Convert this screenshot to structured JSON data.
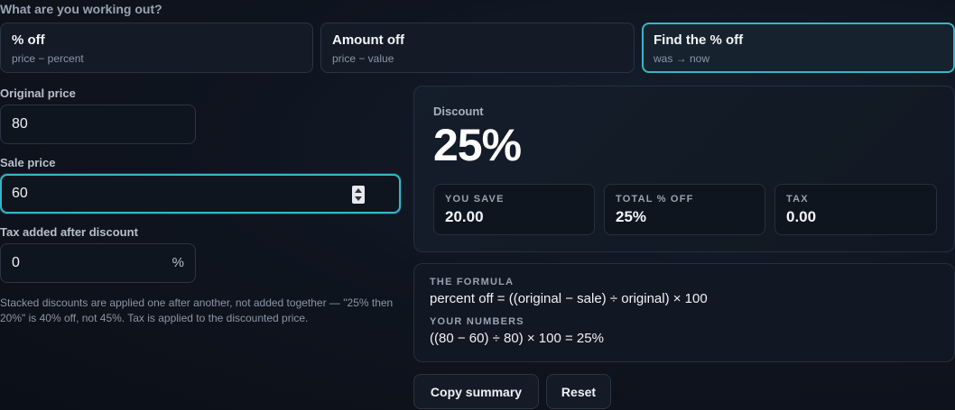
{
  "question": "What are you working out?",
  "modes": [
    {
      "title": "% off",
      "sub": "price − percent"
    },
    {
      "title": "Amount off",
      "sub": "price − value"
    },
    {
      "title": "Find the % off",
      "sub": "was → now"
    }
  ],
  "inputs": {
    "original_label": "Original price",
    "original_value": "80",
    "sale_label": "Sale price",
    "sale_value": "60",
    "tax_label": "Tax added after discount",
    "tax_value": "0",
    "tax_unit": "%"
  },
  "note": "Stacked discounts are applied one after another, not added together — \"25% then 20%\" is 40% off, not 45%. Tax is applied to the discounted price.",
  "result": {
    "label": "Discount",
    "value": "25%",
    "stats": [
      {
        "key": "YOU SAVE",
        "value": "20.00"
      },
      {
        "key": "TOTAL % OFF",
        "value": "25%"
      },
      {
        "key": "TAX",
        "value": "0.00"
      }
    ]
  },
  "formula": {
    "heading": "THE FORMULA",
    "text": "percent off = ((original − sale) ÷ original) × 100",
    "numbers_heading": "YOUR NUMBERS",
    "numbers": "((80 − 60) ÷ 80) × 100 = 25%"
  },
  "actions": {
    "copy": "Copy summary",
    "reset": "Reset"
  },
  "colors": {
    "accent": "#35b6c9",
    "background": "#0f1520"
  }
}
